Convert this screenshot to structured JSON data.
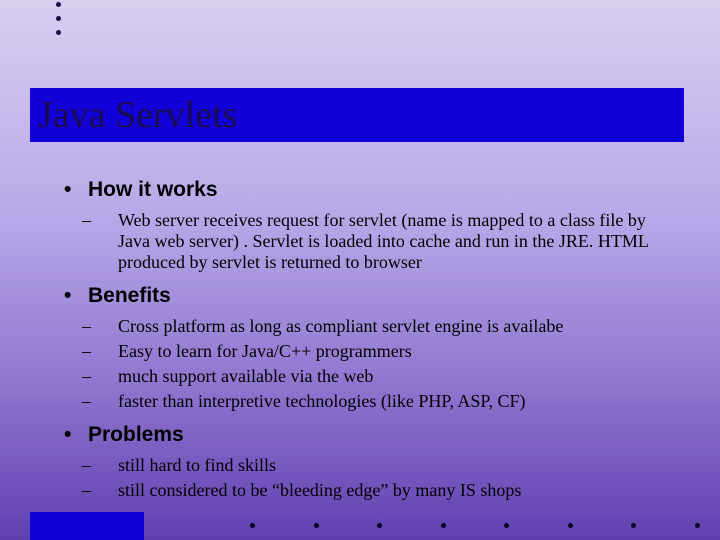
{
  "title": "Java Servlets",
  "sections": [
    {
      "heading": "How it works",
      "items": [
        "Web server receives request for servlet (name is mapped to a class file by Java web server) . Servlet is loaded into cache and run in the JRE. HTML produced by servlet is returned to browser"
      ]
    },
    {
      "heading": "Benefits",
      "items": [
        "Cross platform as long as compliant servlet engine is availabe",
        "Easy to learn for Java/C++ programmers",
        "much support available via the web",
        "faster than interpretive technologies (like PHP, ASP, CF)"
      ]
    },
    {
      "heading": "Problems",
      "items": [
        "still hard to find skills",
        "still considered to be “bleeding edge” by many IS shops"
      ]
    }
  ]
}
